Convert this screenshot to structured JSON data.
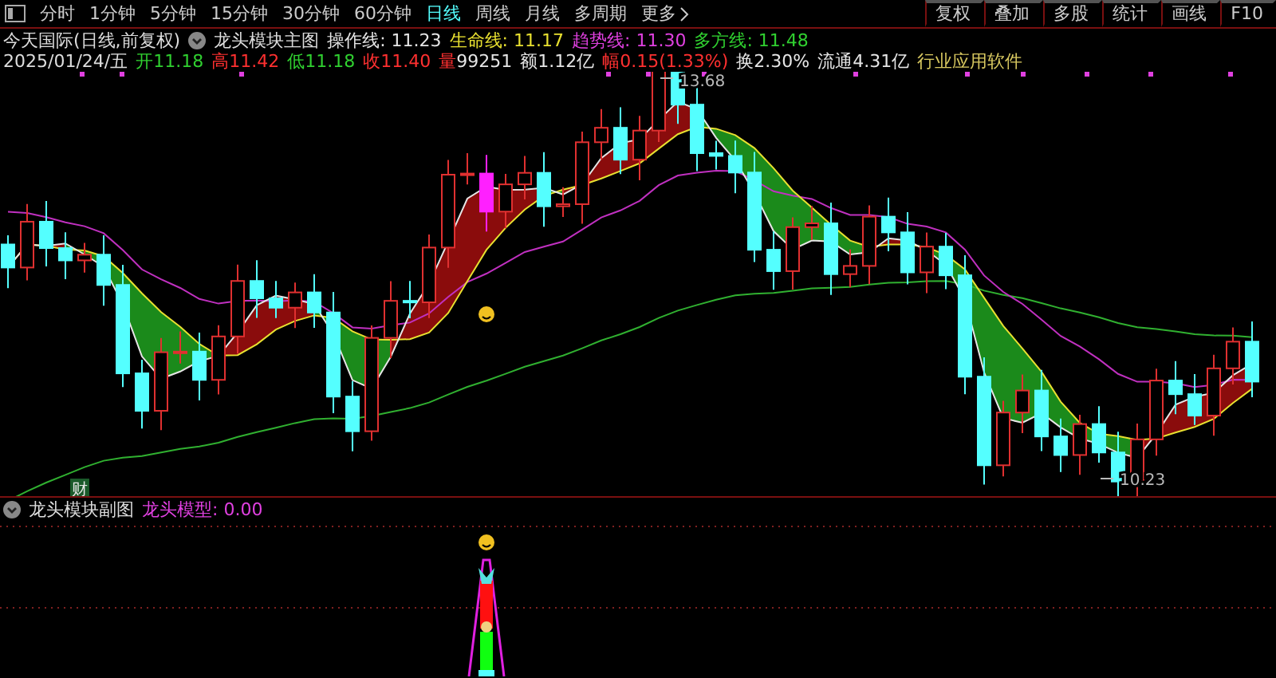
{
  "toolbar": {
    "periods": [
      {
        "label": "分时",
        "selected": false
      },
      {
        "label": "1分钟",
        "selected": false
      },
      {
        "label": "5分钟",
        "selected": false
      },
      {
        "label": "15分钟",
        "selected": false
      },
      {
        "label": "30分钟",
        "selected": false
      },
      {
        "label": "60分钟",
        "selected": false
      },
      {
        "label": "日线",
        "selected": true
      },
      {
        "label": "周线",
        "selected": false
      },
      {
        "label": "月线",
        "selected": false
      },
      {
        "label": "多周期",
        "selected": false
      }
    ],
    "more": "更多",
    "tools": [
      "复权",
      "叠加",
      "多股",
      "统计",
      "画线",
      "F10"
    ]
  },
  "quote": {
    "security": "今天国际(日线,前复权)",
    "indicator": "龙头模块主图",
    "lines": [
      {
        "label": "操作线:",
        "value": "11.23",
        "color": "#e6e6e6"
      },
      {
        "label": "生命线:",
        "value": "11.17",
        "color": "#e8e030"
      },
      {
        "label": "趋势线:",
        "value": "11.30",
        "color": "#e040e0"
      },
      {
        "label": "多方线:",
        "value": "11.48",
        "color": "#30d030"
      }
    ],
    "date": "2025/01/24/五",
    "fields": [
      {
        "label": {
          "text": "开",
          "color": "#30d030"
        },
        "value": {
          "text": "11.18",
          "color": "#30d030"
        }
      },
      {
        "label": {
          "text": "高",
          "color": "#ff3030"
        },
        "value": {
          "text": "11.42",
          "color": "#ff3030"
        }
      },
      {
        "label": {
          "text": "低",
          "color": "#30d030"
        },
        "value": {
          "text": "11.18",
          "color": "#30d030"
        }
      },
      {
        "label": {
          "text": "收",
          "color": "#ff3030"
        },
        "value": {
          "text": "11.40",
          "color": "#ff3030"
        }
      },
      {
        "label": {
          "text": "量",
          "color": "#ff3030"
        },
        "value": {
          "text": "99251",
          "color": "#e6e6e6"
        }
      },
      {
        "label": {
          "text": "额",
          "color": "#e6e6e6"
        },
        "value": {
          "text": "1.12亿",
          "color": "#e6e6e6"
        }
      },
      {
        "label": {
          "text": "幅",
          "color": "#ff3030"
        },
        "value": {
          "text": "0.15(1.33%)",
          "color": "#ff3030"
        }
      },
      {
        "label": {
          "text": "换",
          "color": "#e6e6e6"
        },
        "value": {
          "text": "2.30%",
          "color": "#e6e6e6"
        }
      },
      {
        "label": {
          "text": "流通",
          "color": "#e6e6e6"
        },
        "value": {
          "text": "4.31亿",
          "color": "#e6e6e6"
        }
      }
    ],
    "industry": "行业应用软件"
  },
  "main_chart": {
    "high_label": "13.68",
    "low_label": "10.23",
    "event_marker": "财"
  },
  "sub_chart": {
    "title": "龙头模块副图",
    "lines": [
      {
        "label": "龙头模型:",
        "value": "0.00",
        "color": "#e040e0"
      }
    ]
  }
}
